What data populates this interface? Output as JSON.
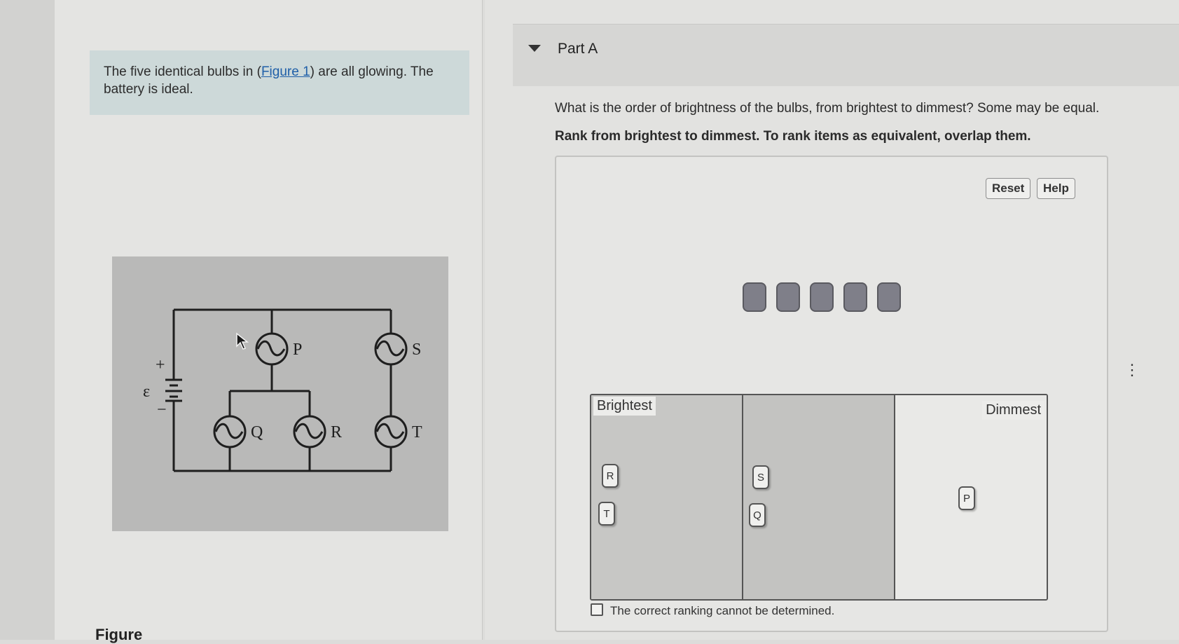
{
  "problem": {
    "text_before": "The five identical bulbs in (",
    "link": "Figure 1",
    "text_after": ") are all glowing. The battery is ideal."
  },
  "figure": {
    "footer_label": "Figure",
    "emf_symbol": "ε",
    "plus": "+",
    "minus": "−",
    "bulbs": [
      "P",
      "Q",
      "R",
      "S",
      "T"
    ]
  },
  "part": {
    "title": "Part A",
    "question": "What is the order of brightness of the bulbs, from brightest to dimmest? Some may be equal.",
    "instruction": "Rank from brightest to dimmest. To rank items as equivalent, overlap them."
  },
  "toolbar": {
    "reset_label": "Reset",
    "help_label": "Help"
  },
  "ranking": {
    "empty_slot_count": 5,
    "brightest_label": "Brightest",
    "dimmest_label": "Dimmest",
    "bins": [
      {
        "items": [
          "R",
          "T"
        ]
      },
      {
        "items": [
          "S",
          "Q"
        ]
      },
      {
        "items": [
          "P"
        ]
      }
    ],
    "cannot_determine_label": "The correct ranking cannot be determined.",
    "cannot_determine_checked": false
  },
  "colors": {
    "prompt_bg": "#cdd9d9",
    "link": "#1f5fa8",
    "slot_fill": "#7f7f89"
  },
  "icons": [
    "collapse-caret-icon",
    "mouse-cursor-icon",
    "more-vertical-icon"
  ]
}
